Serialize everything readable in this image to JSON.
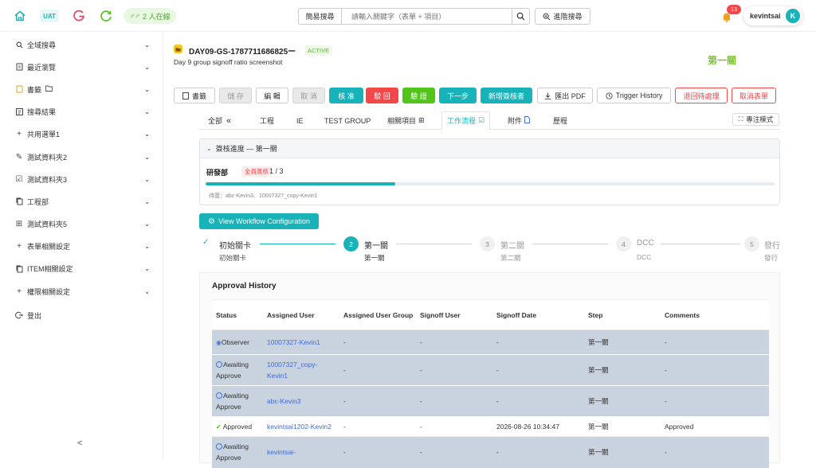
{
  "topbar": {
    "env_badge": "UAT",
    "online": "2 人在線",
    "search_type": "簡易搜尋",
    "search_placeholder": "請輸入關鍵字（表單 + 項目）",
    "advanced_search": "進階搜尋",
    "notif_count": "13",
    "username": "kevintsai",
    "avatar_letter": "K"
  },
  "sidebar": {
    "items": [
      {
        "label": "全域搜尋",
        "icon": "search-icon"
      },
      {
        "label": "最近瀏覽",
        "icon": "document-icon"
      },
      {
        "label": "書籤",
        "icon": "bookmark-icon"
      },
      {
        "label": "搜尋結果",
        "icon": "list-icon"
      },
      {
        "label": "共用選單1",
        "icon": "plus-icon"
      },
      {
        "label": "測試資料夾2",
        "icon": "edit-icon"
      },
      {
        "label": "測試資料夾3",
        "icon": "checkbox-icon"
      },
      {
        "label": "工程部",
        "icon": "copy-icon"
      },
      {
        "label": "測試資料夾5",
        "icon": "grid-icon"
      },
      {
        "label": "表單相關設定",
        "icon": "plus-icon"
      },
      {
        "label": "ITEM相關設定",
        "icon": "copy-icon"
      },
      {
        "label": "權限相關設定",
        "icon": "plus-icon"
      }
    ],
    "logout": "登出",
    "collapse": "<"
  },
  "header": {
    "form_id": "DAY09-GS-1787711686825ー",
    "status": "ACTIVE",
    "subtitle": "Day 9 group signoff ratio screenshot",
    "stage": "第一關"
  },
  "toolbar": {
    "bookmark": "書籤",
    "save": "儲 存",
    "edit": "編 輯",
    "cancel": "取 消",
    "approve": "核 准",
    "reject": "駁 回",
    "verify": "驗 證",
    "next": "下一步",
    "add_signer": "新增簽核者",
    "export_pdf": "匯出 PDF",
    "trigger_history": "Trigger History",
    "return_pending": "退回待處理",
    "cancel_form": "取消表單"
  },
  "tabs": {
    "all": "全部",
    "items": [
      "工程",
      "IE",
      "TEST GROUP",
      "相關項目",
      "工作流程",
      "附件",
      "歷程"
    ],
    "active": "工作流程",
    "focus_mode": "專注模式"
  },
  "progress": {
    "title": "簽核進度 — 第一關",
    "dept": "研發部",
    "rule": "全員簽核",
    "count": "1 / 3",
    "ratio": 0.3333,
    "pending": "待簽：abc-Kevin3、10007327_copy-Kevin1"
  },
  "workflow_button": "View Workflow Configuration",
  "steps": [
    {
      "num": "✓",
      "title": "初始關卡",
      "sub": "初始關卡",
      "state": "done"
    },
    {
      "num": "2",
      "title": "第一關",
      "sub": "第一關",
      "state": "active"
    },
    {
      "num": "3",
      "title": "第二關",
      "sub": "第二關",
      "state": "todo"
    },
    {
      "num": "4",
      "title": "DCC",
      "sub": "DCC",
      "state": "todo"
    },
    {
      "num": "5",
      "title": "發行",
      "sub": "發行",
      "state": "todo"
    }
  ],
  "history": {
    "title": "Approval History",
    "columns": [
      "Status",
      "Assigned User",
      "Assigned User Group",
      "Signoff User",
      "Signoff Date",
      "Step",
      "Comments"
    ],
    "rows": [
      {
        "status": "Observer",
        "status_icon": "eye-icon",
        "user": "10007327-Kevin1",
        "group": "-",
        "signoff_user": "-",
        "date": "-",
        "step": "第一關",
        "comments": "-",
        "shaded": true
      },
      {
        "status": "Awaiting Approve",
        "status_icon": "clock-icon",
        "user": "10007327_copy-Kevin1",
        "group": "-",
        "signoff_user": "-",
        "date": "-",
        "step": "第一關",
        "comments": "-",
        "shaded": true
      },
      {
        "status": "Awaiting Approve",
        "status_icon": "clock-icon",
        "user": "abc-Kevin3",
        "group": "-",
        "signoff_user": "-",
        "date": "-",
        "step": "第一關",
        "comments": "-",
        "shaded": true
      },
      {
        "status": "Approved",
        "status_icon": "check-circle-icon",
        "user": "kevintsai1202-Kevin2",
        "group": "-",
        "signoff_user": "-",
        "date": "2026-08-26 10:34:47",
        "step": "第一關",
        "comments": "Approved",
        "shaded": false
      },
      {
        "status": "Awaiting Approve",
        "status_icon": "clock-icon",
        "user": "kevintsai-",
        "group": "-",
        "signoff_user": "-",
        "date": "-",
        "step": "第一關",
        "comments": "-",
        "shaded": true
      }
    ]
  },
  "colors": {
    "teal": "#17b3b8",
    "red": "#f5474a",
    "green": "#52c41a",
    "stage_green": "#7cc531",
    "link": "#3f6ad8",
    "shaded_row": "#c9d3df"
  }
}
